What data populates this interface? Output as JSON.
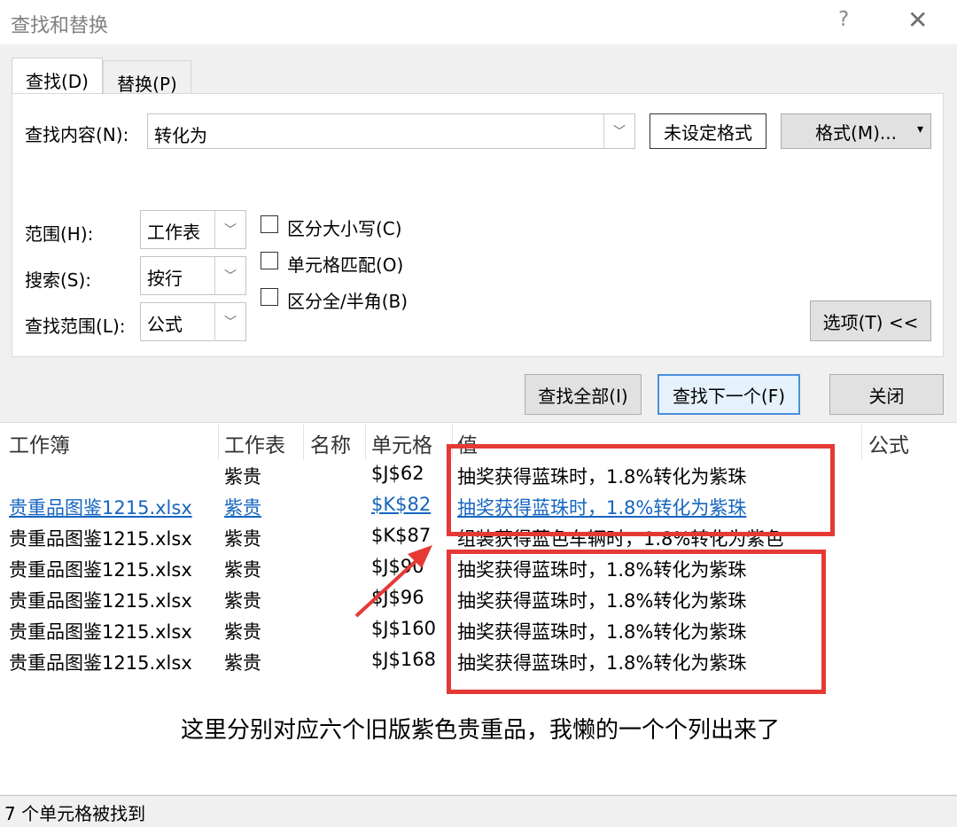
{
  "dialog": {
    "title": "查找和替换",
    "help": "?",
    "close": "✕"
  },
  "tabs": [
    {
      "label": "查找(D)"
    },
    {
      "label": "替换(P)"
    }
  ],
  "find": {
    "label": "查找内容(N):",
    "value": "转化为",
    "format_preview": "未设定格式",
    "format_button": "格式(M)...",
    "format_arrow": "▾"
  },
  "options": {
    "within_label": "范围(H):",
    "within_value": "工作表",
    "search_label": "搜索(S):",
    "search_value": "按行",
    "lookin_label": "查找范围(L):",
    "lookin_value": "公式",
    "match_case": "区分大小写(C)",
    "match_cell": "单元格匹配(O)",
    "match_width": "区分全/半角(B)",
    "options_button": "选项(T) <<"
  },
  "buttons": {
    "find_all": "查找全部(I)",
    "find_next": "查找下一个(F)",
    "close": "关闭"
  },
  "results": {
    "headers": [
      "工作簿",
      "工作表",
      "名称",
      "单元格",
      "值",
      "公式"
    ],
    "rows": [
      {
        "workbook": "",
        "sheet": "紫贵",
        "name": "",
        "cell": "$J$62",
        "value": "抽奖获得蓝珠时，1.8%转化为紫珠"
      },
      {
        "workbook": "贵重品图鉴1215.xlsx",
        "sheet": "紫贵",
        "name": "",
        "cell": "$K$82",
        "value": "抽奖获得蓝珠时，1.8%转化为紫珠"
      },
      {
        "workbook": "贵重品图鉴1215.xlsx",
        "sheet": "紫贵",
        "name": "",
        "cell": "$K$87",
        "value": "组装获得蓝色车辆时，1.8%转化为紫色"
      },
      {
        "workbook": "贵重品图鉴1215.xlsx",
        "sheet": "紫贵",
        "name": "",
        "cell": "$J$90",
        "value": "抽奖获得蓝珠时，1.8%转化为紫珠"
      },
      {
        "workbook": "贵重品图鉴1215.xlsx",
        "sheet": "紫贵",
        "name": "",
        "cell": "$J$96",
        "value": "抽奖获得蓝珠时，1.8%转化为紫珠"
      },
      {
        "workbook": "贵重品图鉴1215.xlsx",
        "sheet": "紫贵",
        "name": "",
        "cell": "$J$160",
        "value": "抽奖获得蓝珠时，1.8%转化为紫珠"
      },
      {
        "workbook": "贵重品图鉴1215.xlsx",
        "sheet": "紫贵",
        "name": "",
        "cell": "$J$168",
        "value": "抽奖获得蓝珠时，1.8%转化为紫珠"
      }
    ]
  },
  "annotation": {
    "text": "这里分别对应六个旧版紫色贵重品，我懒的一个个列出来了",
    "color": "#e53935"
  },
  "status": {
    "text": "7 个单元格被找到"
  },
  "colors": {
    "link": "#1565c0",
    "highlight": "#e53935",
    "focus": "#4a90d9"
  }
}
